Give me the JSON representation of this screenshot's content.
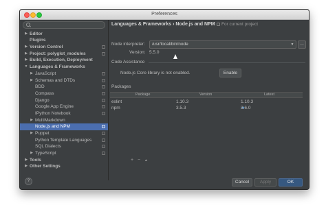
{
  "window": {
    "title": "Preferences"
  },
  "sidebar": {
    "items": [
      {
        "label": "",
        "bold": false,
        "arrow": "",
        "indent": 0
      },
      {
        "label": "Editor",
        "bold": true,
        "arrow": "▶",
        "indent": 0
      },
      {
        "label": "Plugins",
        "bold": true,
        "arrow": "",
        "indent": 0
      },
      {
        "label": "Version Control",
        "bold": true,
        "arrow": "▶",
        "indent": 0,
        "project": true
      },
      {
        "label": "Project: polyglot_modules",
        "bold": true,
        "arrow": "▶",
        "indent": 0,
        "project": true
      },
      {
        "label": "Build, Execution, Deployment",
        "bold": true,
        "arrow": "▶",
        "indent": 0
      },
      {
        "label": "Languages & Frameworks",
        "bold": true,
        "arrow": "▼",
        "indent": 0
      },
      {
        "label": "JavaScript",
        "bold": false,
        "arrow": "▶",
        "indent": 1,
        "project": true
      },
      {
        "label": "Schemas and DTDs",
        "bold": false,
        "arrow": "▶",
        "indent": 1,
        "project": true
      },
      {
        "label": "BDD",
        "bold": false,
        "arrow": "",
        "indent": 1,
        "project": true
      },
      {
        "label": "Compass",
        "bold": false,
        "arrow": "",
        "indent": 1,
        "project": true
      },
      {
        "label": "Django",
        "bold": false,
        "arrow": "",
        "indent": 1,
        "project": true
      },
      {
        "label": "Google App Engine",
        "bold": false,
        "arrow": "",
        "indent": 1,
        "project": true
      },
      {
        "label": "IPython Notebook",
        "bold": false,
        "arrow": "",
        "indent": 1,
        "project": true
      },
      {
        "label": "MultiMarkdown",
        "bold": false,
        "arrow": "▶",
        "indent": 1
      },
      {
        "label": "Node.js and NPM",
        "bold": false,
        "arrow": "",
        "indent": 1,
        "project": true,
        "selected": true
      },
      {
        "label": "Puppet",
        "bold": false,
        "arrow": "▶",
        "indent": 1,
        "project": true
      },
      {
        "label": "Python Template Languages",
        "bold": false,
        "arrow": "",
        "indent": 1,
        "project": true
      },
      {
        "label": "SQL Dialects",
        "bold": false,
        "arrow": "",
        "indent": 1,
        "project": true
      },
      {
        "label": "TypeScript",
        "bold": false,
        "arrow": "▶",
        "indent": 1,
        "project": true
      },
      {
        "label": "Tools",
        "bold": true,
        "arrow": "▶",
        "indent": 0
      },
      {
        "label": "Other Settings",
        "bold": true,
        "arrow": "▶",
        "indent": 0
      }
    ]
  },
  "main": {
    "breadcrumb": "Languages & Frameworks › Node.js and NPM",
    "scope": "For current project",
    "interpreter_label": "Node interpreter:",
    "interpreter_value": "/usr/local/bin/node",
    "version_label": "Version:",
    "version_value": "5.5.0",
    "code_assist_title": "Code Assistance",
    "core_lib_text": "Node.js Core library is not enabled.",
    "enable_button": "Enable",
    "packages_title": "Packages",
    "table": {
      "columns": [
        "Package",
        "Version",
        "Latest"
      ],
      "rows": [
        {
          "package": "eslint",
          "version": "1.10.3",
          "latest": "1.10.3",
          "upgrade": false
        },
        {
          "package": "npm",
          "version": "3.5.3",
          "latest": "3.6.0",
          "upgrade": true
        }
      ]
    },
    "toolbar": {
      "add": "+",
      "remove": "−",
      "upgrade": "▲"
    }
  },
  "footer": {
    "help": "?",
    "cancel": "Cancel",
    "apply": "Apply",
    "ok": "OK"
  }
}
